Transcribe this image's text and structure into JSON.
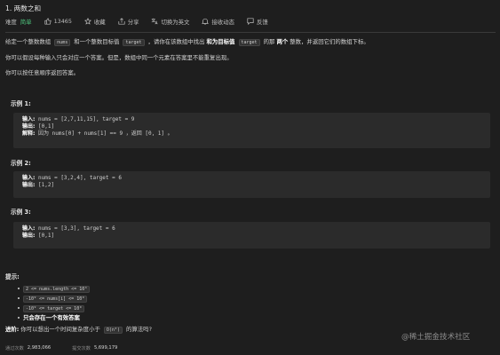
{
  "problem": {
    "title": "1. 两数之和",
    "difficulty_label": "难度",
    "difficulty": "简单",
    "likes": "13465",
    "collect": "收藏",
    "share": "分享",
    "switch_lang": "切换为英文",
    "notify": "接收动态",
    "feedback": "反馈"
  },
  "description": {
    "p1_a": "给定一个整数数组",
    "p1_nums": "nums",
    "p1_b": "和一个整数目标值",
    "p1_target": "target",
    "p1_c": "，请你在该数组中找出",
    "p1_d": "和为目标值",
    "p1_target2": "target",
    "p1_e": "的那",
    "p1_f": "两个",
    "p1_g": "整数，并返回它们的数组下标。",
    "p2": "你可以假设每种输入只会对应一个答案。但是，数组中同一个元素在答案里不能重复出现。",
    "p3": "你可以按任意顺序返回答案。"
  },
  "examples": [
    {
      "title": "示例 1:",
      "input_label": "输入:",
      "input": "nums = [2,7,11,15], target = 9",
      "output_label": "输出:",
      "output": "[0,1]",
      "explain_label": "解释:",
      "explain": "因为 nums[0] + nums[1] == 9 ，返回 [0, 1] 。"
    },
    {
      "title": "示例 2:",
      "input_label": "输入:",
      "input": "nums = [3,2,4], target = 6",
      "output_label": "输出:",
      "output": "[1,2]"
    },
    {
      "title": "示例 3:",
      "input_label": "输入:",
      "input": "nums = [3,3], target = 6",
      "output_label": "输出:",
      "output": "[0,1]"
    }
  ],
  "constraints": {
    "title": "提示:",
    "items": [
      "2 <= nums.length <= 10⁴",
      "-10⁹ <= nums[i] <= 10⁹",
      "-10⁹ <= target <= 10⁹",
      "只会存在一个有效答案"
    ]
  },
  "advanced": {
    "label": "进阶:",
    "text_a": "你可以想出一个时间复杂度小于",
    "complexity": "O(n²)",
    "text_b": "的算法吗?"
  },
  "footer": {
    "pass_label": "通过次数",
    "pass_value": "2,983,066",
    "submit_label": "提交次数",
    "submit_value": "5,699,179"
  },
  "watermark": "@稀土掘金技术社区"
}
